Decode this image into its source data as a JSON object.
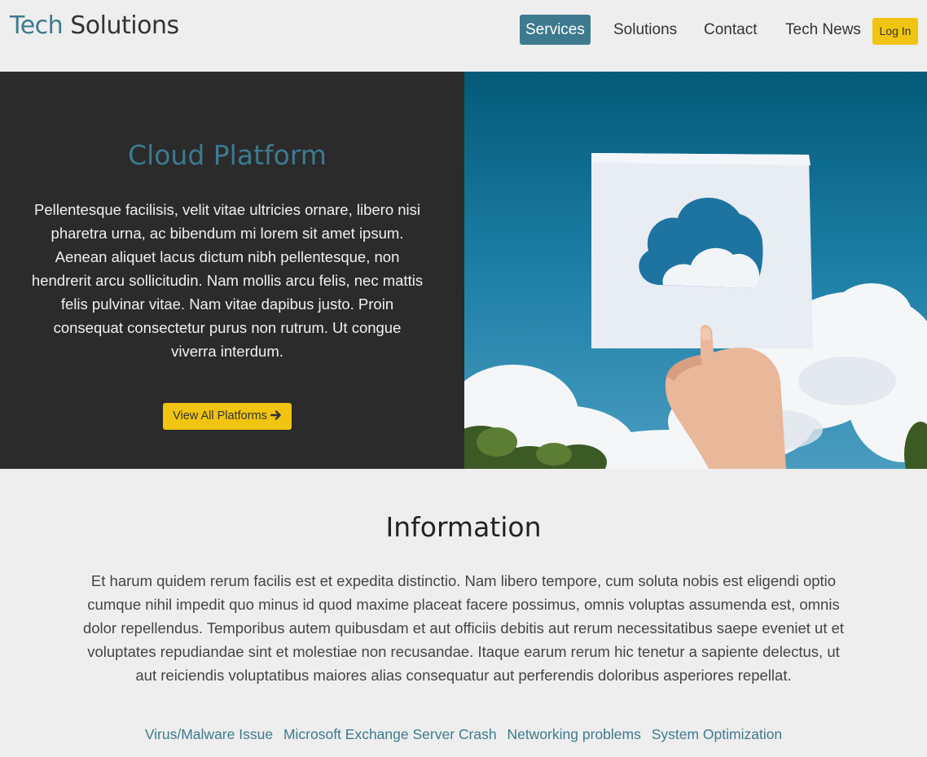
{
  "header": {
    "logo_part1": "Tech",
    "logo_part2": "Solutions",
    "nav": [
      {
        "label": "Services",
        "active": true
      },
      {
        "label": "Solutions",
        "active": false
      },
      {
        "label": "Contact",
        "active": false
      },
      {
        "label": "Tech News",
        "active": false
      }
    ],
    "login_label": "Log In"
  },
  "hero": {
    "title": "Cloud Platform",
    "text": "Pellentesque facilisis, velit vitae ultricies ornare, libero nisi pharetra urna, ac bibendum mi lorem sit amet ipsum. Aenean aliquet lacus dictum nibh pellentesque, non hendrerit arcu sollicitudin. Nam mollis arcu felis, nec mattis felis pulvinar vitae. Nam vitae dapibus justo. Proin consequat consectetur purus non rutrum. Ut congue viverra interdum.",
    "button_label": "View All Platforms",
    "button_icon": "arrow-right-icon"
  },
  "info": {
    "title": "Information",
    "text": "Et harum quidem rerum facilis est et expedita distinctio. Nam libero tempore, cum soluta nobis est eligendi optio cumque nihil impedit quo minus id quod maxime placeat facere possimus, omnis voluptas assumenda est, omnis dolor repellendus. Temporibus autem quibusdam et aut officiis debitis aut rerum necessitatibus saepe eveniet ut et voluptates repudiandae sint et molestiae non recusandae. Itaque earum rerum hic tenetur a sapiente delectus, ut aut reiciendis voluptatibus maiores alias consequatur aut perferendis doloribus asperiores repellat.",
    "links": [
      "Virus/Malware Issue",
      "Microsoft Exchange Server Crash",
      "Networking problems",
      "System Optimization"
    ]
  },
  "colors": {
    "accent": "#3d7a8f",
    "button": "#f1c40f",
    "hero_bg": "#2b2b2b",
    "page_bg": "#eeeeee"
  }
}
